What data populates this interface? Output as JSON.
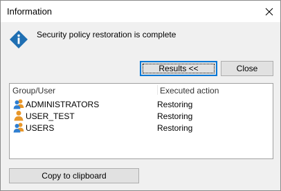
{
  "window": {
    "title": "Information",
    "close_icon": "close-icon"
  },
  "message": {
    "icon": "info-icon",
    "text": "Security policy restoration is complete",
    "accent": "#1f6fb2"
  },
  "buttons": {
    "results_label": "Results <<",
    "close_label": "Close",
    "copy_label": "Copy to clipboard"
  },
  "list": {
    "columns": [
      "Group/User",
      "Executed action"
    ],
    "rows": [
      {
        "name": "ADMINISTRATORS",
        "action": "Restoring",
        "icon": "group-icon"
      },
      {
        "name": "USER_TEST",
        "action": "Restoring",
        "icon": "user-icon"
      },
      {
        "name": "USERS",
        "action": "Restoring",
        "icon": "group-icon"
      }
    ]
  }
}
